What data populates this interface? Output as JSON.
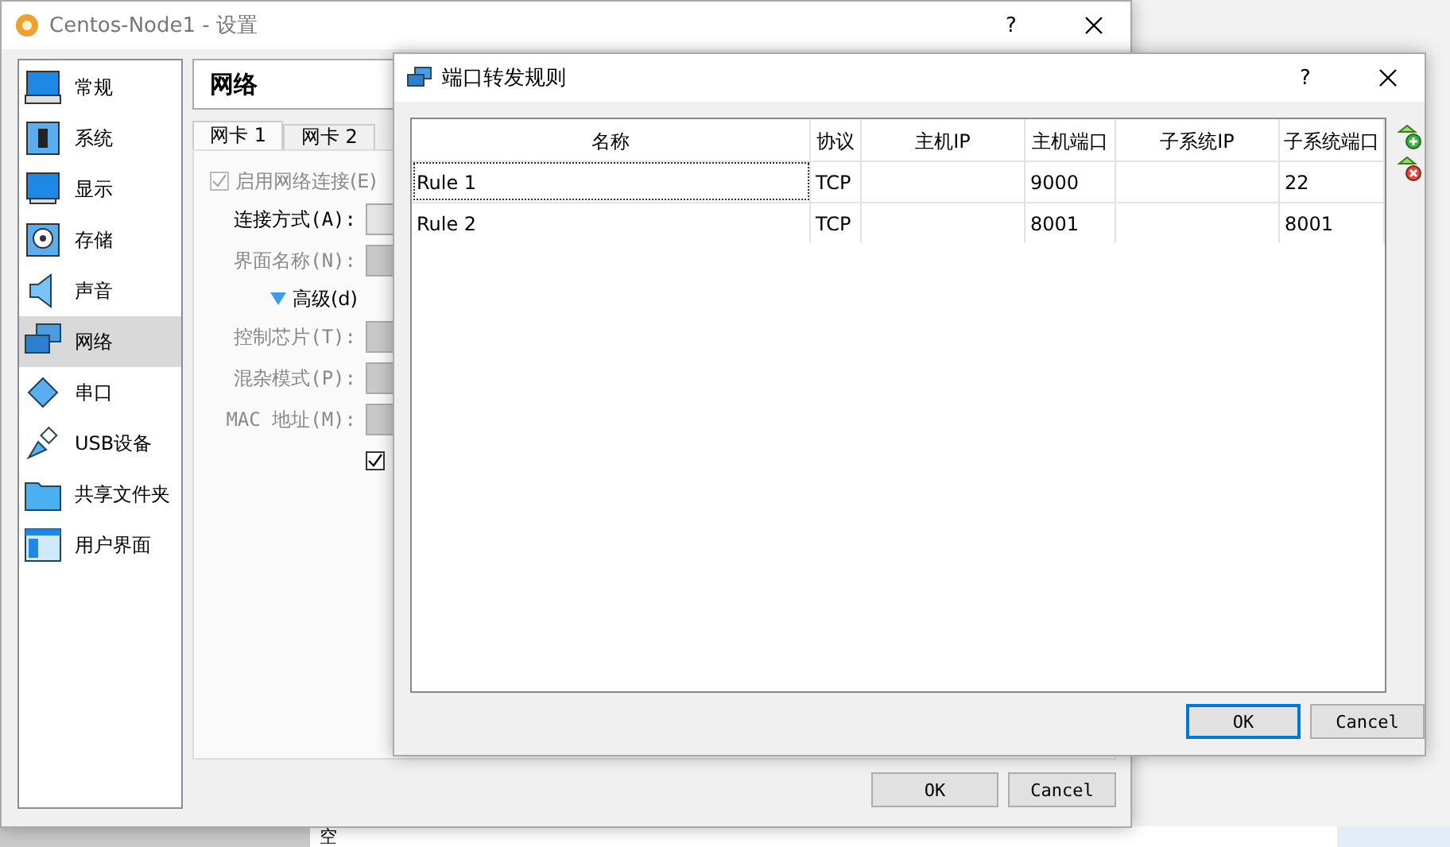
{
  "desktop": {
    "text": "空"
  },
  "settings_window": {
    "title": "Centos-Node1 - 设置",
    "help": "?",
    "sidebar": {
      "items": [
        {
          "label": "常规",
          "selected": false
        },
        {
          "label": "系统",
          "selected": false
        },
        {
          "label": "显示",
          "selected": false
        },
        {
          "label": "存储",
          "selected": false
        },
        {
          "label": "声音",
          "selected": false
        },
        {
          "label": "网络",
          "selected": true
        },
        {
          "label": "串口",
          "selected": false
        },
        {
          "label": "USB设备",
          "selected": false
        },
        {
          "label": "共享文件夹",
          "selected": false
        },
        {
          "label": "用户界面",
          "selected": false
        }
      ]
    },
    "page_title": "网络",
    "tabs": [
      {
        "label": "网卡 1",
        "selected": true
      },
      {
        "label": "网卡 2",
        "selected": false
      }
    ],
    "enable_checkbox": {
      "label": "启用网络连接(E)",
      "checked": true,
      "disabled": true
    },
    "fields": [
      {
        "label": "连接方式(A):",
        "disabled": false
      },
      {
        "label": "界面名称(N):",
        "disabled": true
      }
    ],
    "advanced": {
      "label": "高级(d)",
      "expanded": true
    },
    "advanced_fields": [
      {
        "label": "控制芯片(T):",
        "disabled": true
      },
      {
        "label": "混杂模式(P):",
        "disabled": true
      },
      {
        "label": "MAC 地址(M):",
        "disabled": true
      }
    ],
    "cable_checkbox": {
      "checked": true
    },
    "buttons": [
      {
        "label": "OK",
        "default": false
      },
      {
        "label": "Cancel",
        "default": false
      }
    ]
  },
  "dialog": {
    "title": "端口转发规则",
    "help": "?",
    "columns": [
      "名称",
      "协议",
      "主机IP",
      "主机端口",
      "子系统IP",
      "子系统端口"
    ],
    "rows": [
      {
        "cells": [
          "Rule 1",
          "TCP",
          "",
          "9000",
          "",
          "22"
        ],
        "focused": true
      },
      {
        "cells": [
          "Rule 2",
          "TCP",
          "",
          "8001",
          "",
          "8001"
        ],
        "focused": false
      }
    ],
    "buttons": [
      {
        "label": "OK",
        "default": true
      },
      {
        "label": "Cancel",
        "default": false
      }
    ]
  }
}
